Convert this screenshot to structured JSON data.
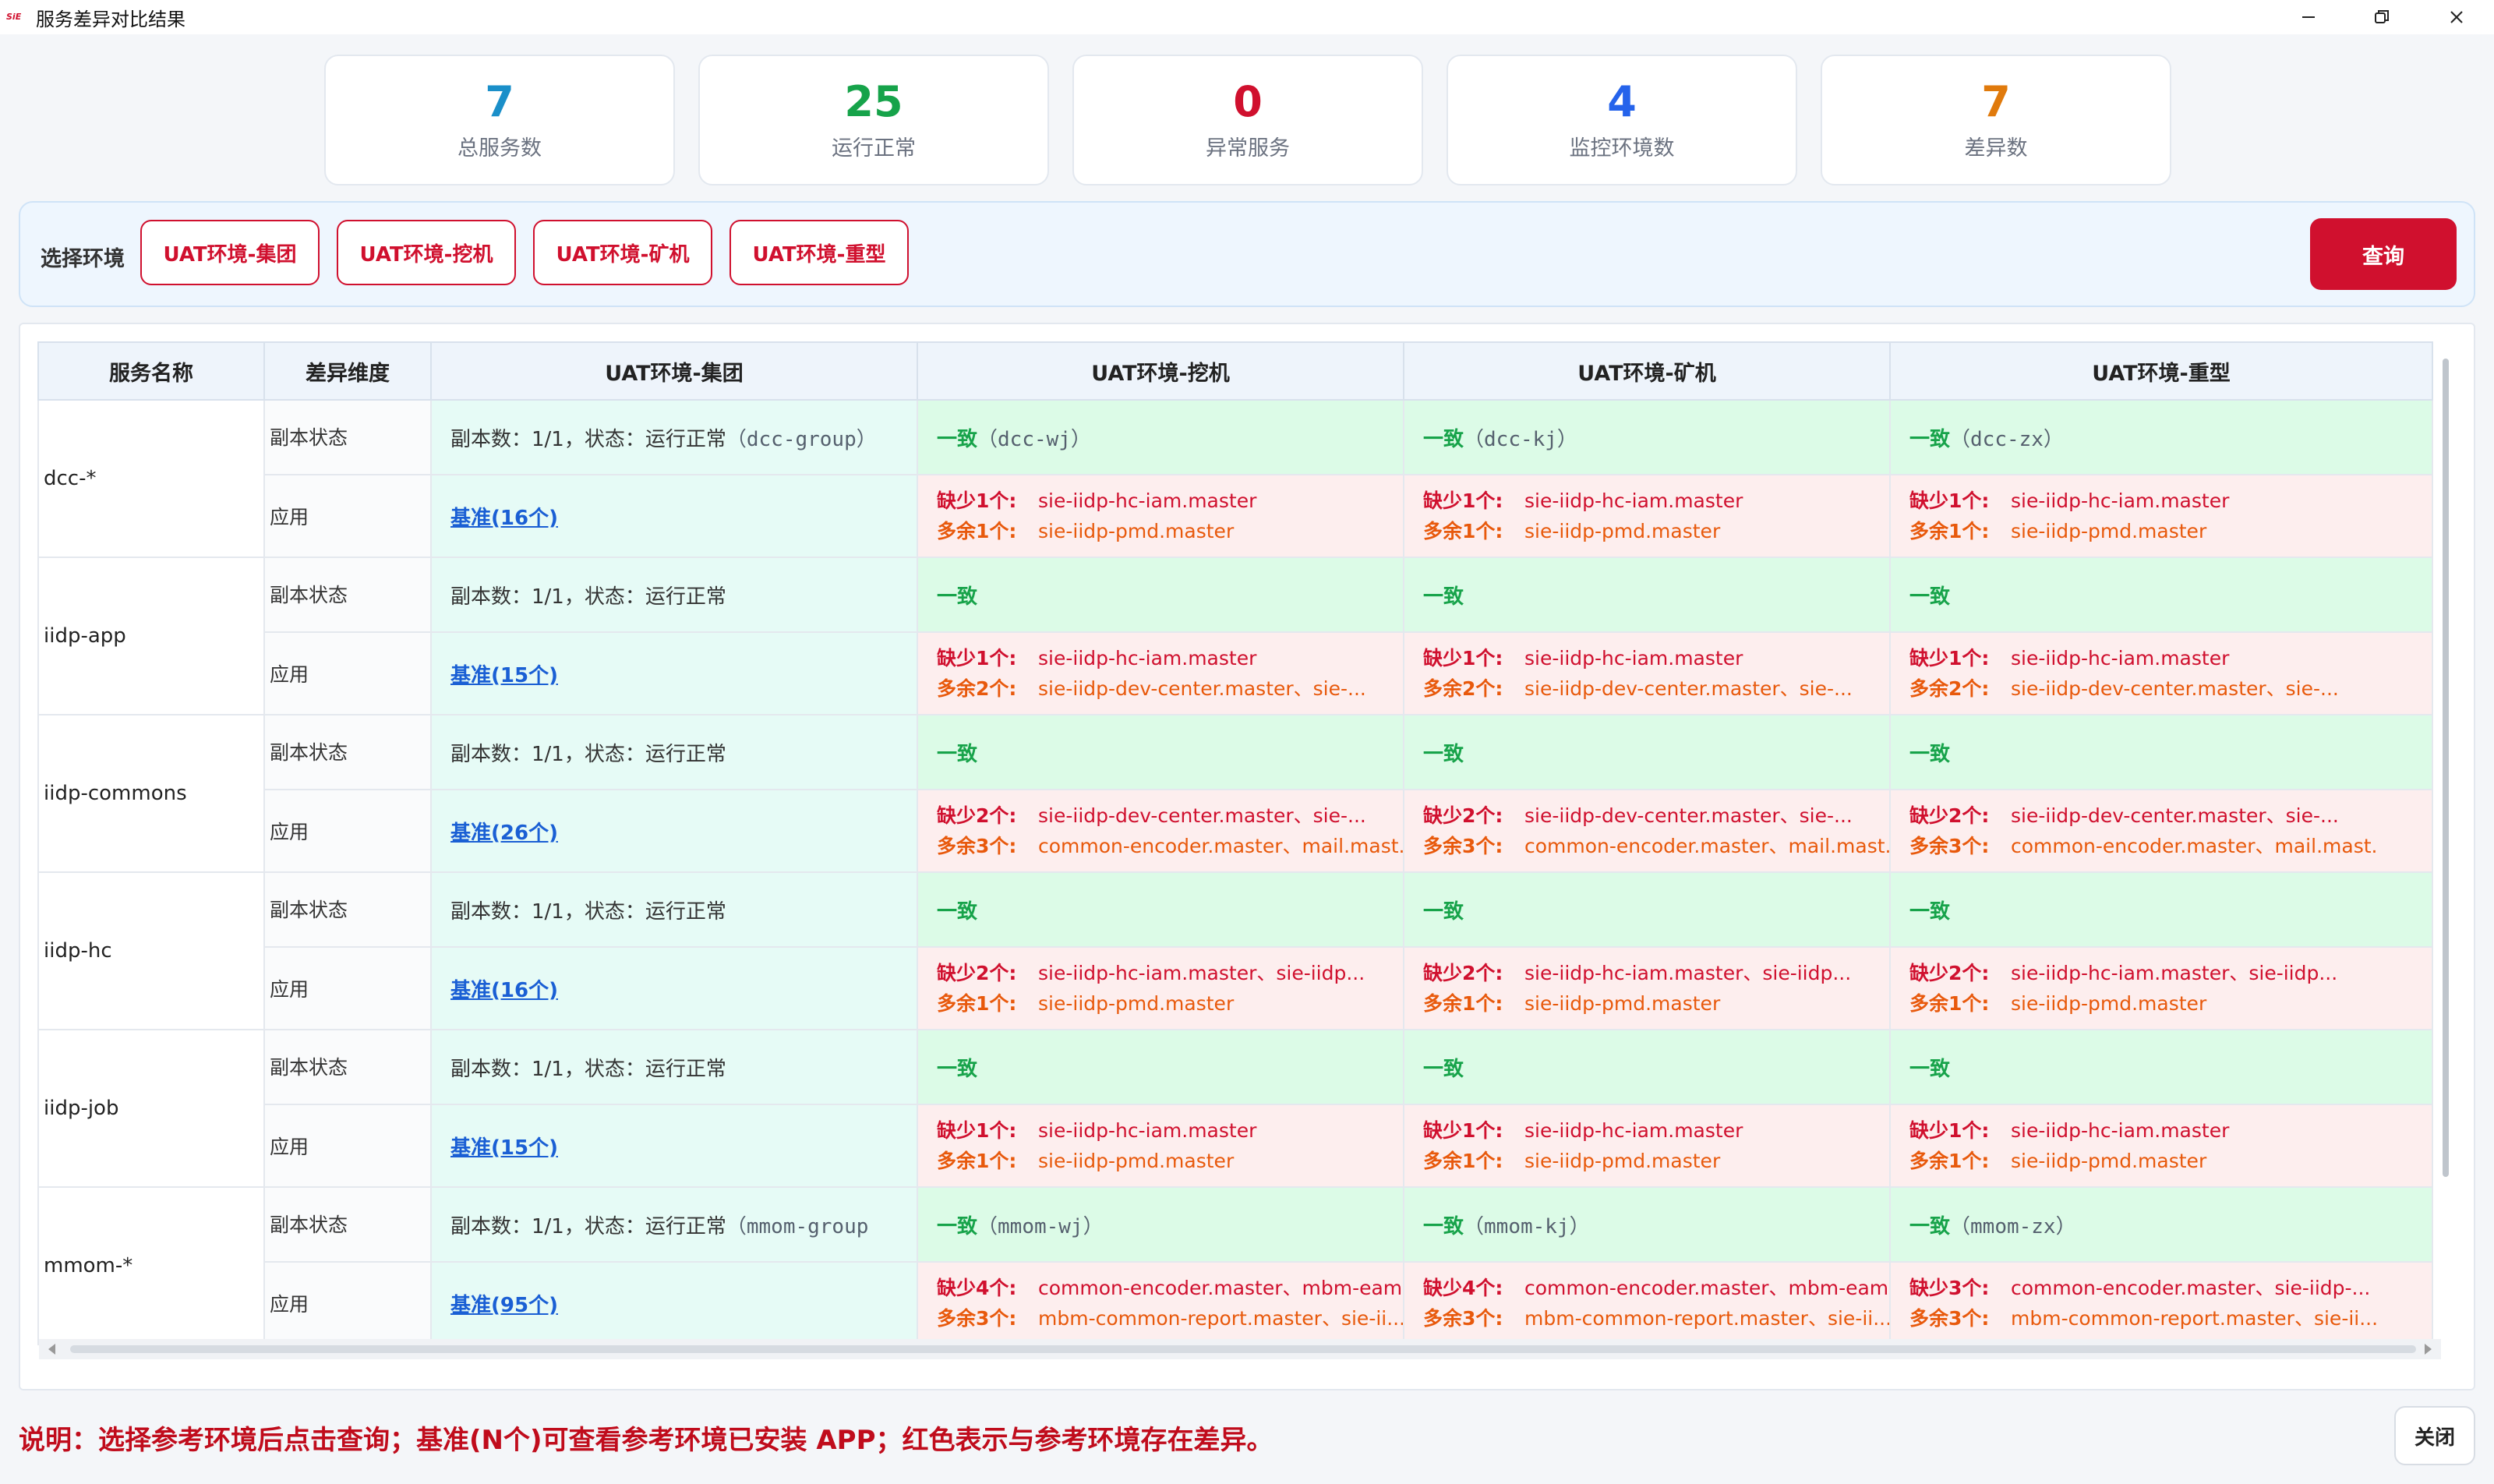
{
  "window": {
    "title": "服务差异对比结果",
    "logo_text": "SiE"
  },
  "stats": [
    {
      "value": "7",
      "label": "总服务数",
      "color": "#1a8fc9"
    },
    {
      "value": "25",
      "label": "运行正常",
      "color": "#16a34a"
    },
    {
      "value": "0",
      "label": "异常服务",
      "color": "#d0102e"
    },
    {
      "value": "4",
      "label": "监控环境数",
      "color": "#2563eb"
    },
    {
      "value": "7",
      "label": "差异数",
      "color": "#e07a0c"
    }
  ],
  "env_select": {
    "label": "选择环境",
    "options": [
      "UAT环境-集团",
      "UAT环境-挖机",
      "UAT环境-矿机",
      "UAT环境-重型"
    ],
    "query_label": "查询"
  },
  "table": {
    "headers": [
      "服务名称",
      "差异维度",
      "UAT环境-集团",
      "UAT环境-挖机",
      "UAT环境-矿机",
      "UAT环境-重型"
    ],
    "dim_replica": "副本状态",
    "dim_app": "应用",
    "ok_word": "一致",
    "replica_text": "副本数：1/1，状态：运行正常",
    "services": [
      {
        "name": "dcc-*",
        "replica_suffix": "（dcc-group）",
        "ok_suffixes": [
          "（dcc-wj）",
          "（dcc-kj）",
          "（dcc-zx）"
        ],
        "base_link": "基准(16个)",
        "diffs": [
          {
            "miss_label": "缺少1个:",
            "miss": "sie-iidp-hc-iam.master",
            "extra_label": "多余1个:",
            "extra": "sie-iidp-pmd.master"
          },
          {
            "miss_label": "缺少1个:",
            "miss": "sie-iidp-hc-iam.master",
            "extra_label": "多余1个:",
            "extra": "sie-iidp-pmd.master"
          },
          {
            "miss_label": "缺少1个:",
            "miss": "sie-iidp-hc-iam.master",
            "extra_label": "多余1个:",
            "extra": "sie-iidp-pmd.master"
          }
        ]
      },
      {
        "name": "iidp-app",
        "replica_suffix": "",
        "ok_suffixes": [
          "",
          "",
          ""
        ],
        "base_link": "基准(15个)",
        "diffs": [
          {
            "miss_label": "缺少1个:",
            "miss": "sie-iidp-hc-iam.master",
            "extra_label": "多余2个:",
            "extra": "sie-iidp-dev-center.master、sie-..."
          },
          {
            "miss_label": "缺少1个:",
            "miss": "sie-iidp-hc-iam.master",
            "extra_label": "多余2个:",
            "extra": "sie-iidp-dev-center.master、sie-..."
          },
          {
            "miss_label": "缺少1个:",
            "miss": "sie-iidp-hc-iam.master",
            "extra_label": "多余2个:",
            "extra": "sie-iidp-dev-center.master、sie-..."
          }
        ]
      },
      {
        "name": "iidp-commons",
        "replica_suffix": "",
        "ok_suffixes": [
          "",
          "",
          ""
        ],
        "base_link": "基准(26个)",
        "diffs": [
          {
            "miss_label": "缺少2个:",
            "miss": "sie-iidp-dev-center.master、sie-...",
            "extra_label": "多余3个:",
            "extra": "common-encoder.master、mail.mast..."
          },
          {
            "miss_label": "缺少2个:",
            "miss": "sie-iidp-dev-center.master、sie-...",
            "extra_label": "多余3个:",
            "extra": "common-encoder.master、mail.mast..."
          },
          {
            "miss_label": "缺少2个:",
            "miss": "sie-iidp-dev-center.master、sie-...",
            "extra_label": "多余3个:",
            "extra": "common-encoder.master、mail.mast..."
          }
        ]
      },
      {
        "name": "iidp-hc",
        "replica_suffix": "",
        "ok_suffixes": [
          "",
          "",
          ""
        ],
        "base_link": "基准(16个)",
        "diffs": [
          {
            "miss_label": "缺少2个:",
            "miss": "sie-iidp-hc-iam.master、sie-iidp...",
            "extra_label": "多余1个:",
            "extra": "sie-iidp-pmd.master"
          },
          {
            "miss_label": "缺少2个:",
            "miss": "sie-iidp-hc-iam.master、sie-iidp...",
            "extra_label": "多余1个:",
            "extra": "sie-iidp-pmd.master"
          },
          {
            "miss_label": "缺少2个:",
            "miss": "sie-iidp-hc-iam.master、sie-iidp...",
            "extra_label": "多余1个:",
            "extra": "sie-iidp-pmd.master"
          }
        ]
      },
      {
        "name": "iidp-job",
        "replica_suffix": "",
        "ok_suffixes": [
          "",
          "",
          ""
        ],
        "base_link": "基准(15个)",
        "diffs": [
          {
            "miss_label": "缺少1个:",
            "miss": "sie-iidp-hc-iam.master",
            "extra_label": "多余1个:",
            "extra": "sie-iidp-pmd.master"
          },
          {
            "miss_label": "缺少1个:",
            "miss": "sie-iidp-hc-iam.master",
            "extra_label": "多余1个:",
            "extra": "sie-iidp-pmd.master"
          },
          {
            "miss_label": "缺少1个:",
            "miss": "sie-iidp-hc-iam.master",
            "extra_label": "多余1个:",
            "extra": "sie-iidp-pmd.master"
          }
        ]
      },
      {
        "name": "mmom-*",
        "replica_suffix": "（mmom-group",
        "ok_suffixes": [
          "（mmom-wj）",
          "（mmom-kj）",
          "（mmom-zx）"
        ],
        "base_link": "基准(95个)",
        "diffs": [
          {
            "miss_label": "缺少4个:",
            "miss": "common-encoder.master、mbm-eam-t",
            "extra_label": "多余3个:",
            "extra": "mbm-common-report.master、sie-ii..."
          },
          {
            "miss_label": "缺少4个:",
            "miss": "common-encoder.master、mbm-eam-t",
            "extra_label": "多余3个:",
            "extra": "mbm-common-report.master、sie-ii..."
          },
          {
            "miss_label": "缺少3个:",
            "miss": "common-encoder.master、sie-iidp-...",
            "extra_label": "多余3个:",
            "extra": "mbm-common-report.master、sie-ii..."
          }
        ]
      }
    ]
  },
  "footer": {
    "note": "说明：选择参考环境后点击查询；基准(N个)可查看参考环境已安装 APP；红色表示与参考环境存在差异。",
    "close_label": "关闭"
  }
}
